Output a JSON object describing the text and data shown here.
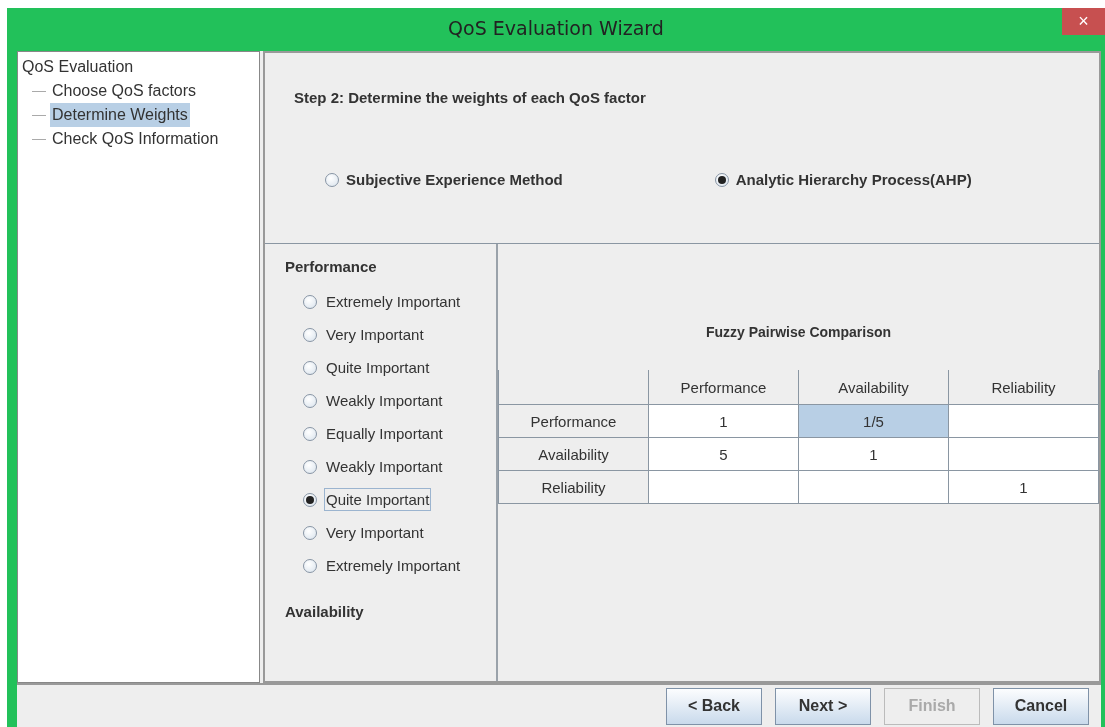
{
  "window": {
    "title": "QoS Evaluation Wizard",
    "close": "×"
  },
  "tree": {
    "label": "QoS Evaluation",
    "selected": false,
    "children": [
      {
        "label": "Choose QoS factors",
        "selected": false
      },
      {
        "label": "Determine Weights",
        "selected": true
      },
      {
        "label": "Check QoS Information",
        "selected": false
      }
    ]
  },
  "step_title": "Step 2: Determine the weights of each QoS factor",
  "methods": [
    {
      "label": "Subjective Experience Method",
      "selected": false
    },
    {
      "label": "Analytic Hierarchy Process(AHP)",
      "selected": true
    }
  ],
  "factor_groups": [
    {
      "title": "Performance",
      "options": [
        {
          "label": "Extremely Important",
          "selected": false
        },
        {
          "label": "Very Important",
          "selected": false
        },
        {
          "label": "Quite Important",
          "selected": false
        },
        {
          "label": "Weakly Important",
          "selected": false
        },
        {
          "label": "Equally Important",
          "selected": false
        },
        {
          "label": "Weakly Important",
          "selected": false
        },
        {
          "label": "Quite Important",
          "selected": true
        },
        {
          "label": "Very Important",
          "selected": false
        },
        {
          "label": "Extremely Important",
          "selected": false
        }
      ]
    },
    {
      "title": "Availability"
    }
  ],
  "comparison": {
    "title": "Fuzzy Pairwise Comparison",
    "columns": [
      "Performance",
      "Availability",
      "Reliability"
    ],
    "rows": [
      {
        "header": "Performance",
        "cells": [
          {
            "value": "1",
            "selected": false
          },
          {
            "value": "1/5",
            "selected": true
          },
          {
            "selected": false
          }
        ]
      },
      {
        "header": "Availability",
        "cells": [
          {
            "value": "5",
            "selected": false
          },
          {
            "value": "1",
            "selected": false
          },
          {
            "selected": false
          }
        ]
      },
      {
        "header": "Reliability",
        "cells": [
          {
            "selected": false
          },
          {
            "selected": false
          },
          {
            "value": "1",
            "selected": false
          }
        ]
      }
    ]
  },
  "buttons": [
    {
      "label": "< Back",
      "disabled": false
    },
    {
      "label": "Next >",
      "disabled": false
    },
    {
      "label": "Finish",
      "disabled": true
    },
    {
      "label": "Cancel",
      "disabled": false
    }
  ]
}
